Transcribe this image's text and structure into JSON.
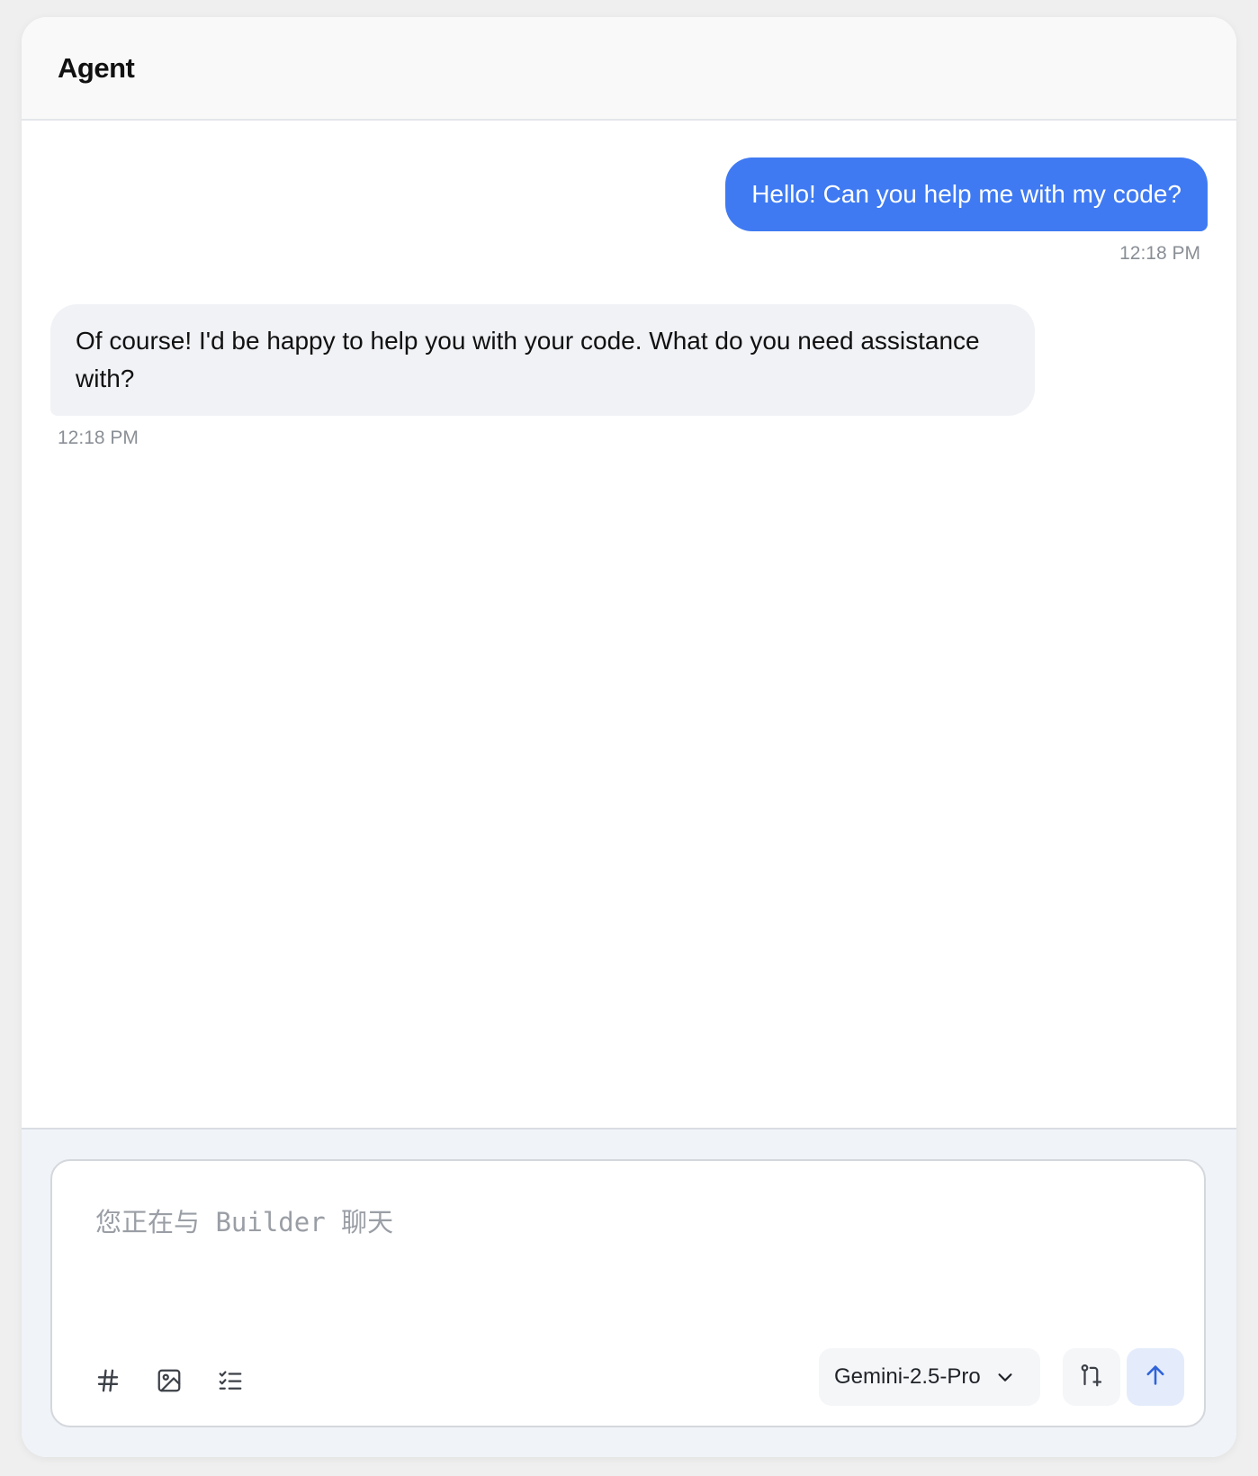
{
  "header": {
    "title": "Agent"
  },
  "messages": [
    {
      "role": "user",
      "text": "Hello! Can you help me with my code?",
      "time": "12:18 PM"
    },
    {
      "role": "assistant",
      "text": "Of course! I'd be happy to help you with your code. What do you need assistance with?",
      "time": "12:18 PM"
    }
  ],
  "composer": {
    "placeholder": "您正在与 Builder 聊天",
    "value": "",
    "tools": [
      {
        "icon": "hash-icon"
      },
      {
        "icon": "image-icon"
      },
      {
        "icon": "checklist-icon"
      }
    ],
    "model": {
      "selected": "Gemini-2.5-Pro",
      "icon": "chevron-down-icon"
    },
    "branch_icon": "git-pull-request-icon",
    "send_icon": "arrow-up-icon"
  },
  "colors": {
    "accent": "#3f7af2",
    "user_bubble_text": "#ffffff",
    "assistant_bubble": "#f1f2f6",
    "timestamp": "#8a8f96",
    "send_button_bg": "#e4ecfc",
    "send_icon": "#2f63d9",
    "composer_area_bg": "#f0f3f8"
  }
}
